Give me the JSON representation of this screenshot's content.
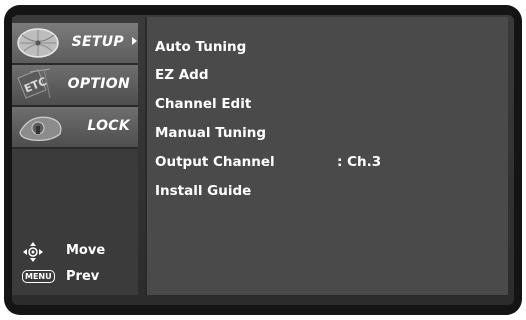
{
  "sidebar": {
    "tabs": [
      {
        "label": "SETUP",
        "icon": "satellite-dish-icon",
        "active": true
      },
      {
        "label": "OPTION",
        "icon": "etc-icon",
        "active": false
      },
      {
        "label": "LOCK",
        "icon": "lock-icon",
        "active": false
      }
    ],
    "hints": {
      "move_label": "Move",
      "move_icon": "direction-pad-icon",
      "prev_key": "MENU",
      "prev_label": "Prev"
    }
  },
  "menu": {
    "items": [
      {
        "label": "Auto Tuning"
      },
      {
        "label": "EZ Add"
      },
      {
        "label": "Channel Edit"
      },
      {
        "label": "Manual Tuning"
      },
      {
        "label": "Output Channel",
        "value": ": Ch.3"
      },
      {
        "label": "Install Guide"
      }
    ]
  },
  "colors": {
    "frame": "#141414",
    "sidebar": "#3b3b3b",
    "content": "#4a4a4a",
    "text": "#ffffff"
  }
}
